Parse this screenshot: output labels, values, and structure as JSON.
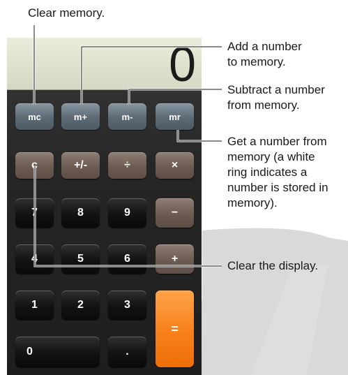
{
  "display": {
    "value": "0"
  },
  "memory_keys": {
    "mc": "mc",
    "m_plus": "m+",
    "m_minus": "m-",
    "mr": "mr"
  },
  "operator_keys": {
    "clear": "c",
    "plus_minus": "+/-",
    "divide": "÷",
    "multiply": "×",
    "minus": "−",
    "plus": "+",
    "equals": "="
  },
  "number_keys": {
    "seven": "7",
    "eight": "8",
    "nine": "9",
    "four": "4",
    "five": "5",
    "six": "6",
    "one": "1",
    "two": "2",
    "three": "3",
    "zero": "0",
    "decimal": "."
  },
  "callouts": {
    "clear_memory": "Clear memory.",
    "add_to_memory_1": "Add a number",
    "add_to_memory_2": "to memory.",
    "subtract_memory_1": "Subtract a number",
    "subtract_memory_2": "from memory.",
    "get_memory_1": "Get a number from",
    "get_memory_2": "memory (a white",
    "get_memory_3": "ring indicates a",
    "get_memory_4": "number is stored in",
    "get_memory_5": "memory).",
    "clear_display": "Clear the display."
  },
  "colors": {
    "memory_key": "#5c6a75",
    "operator_key": "#6b5b51",
    "number_key": "#121212",
    "equals_key": "#f7801a",
    "display_bg": "#e9ecd9"
  }
}
